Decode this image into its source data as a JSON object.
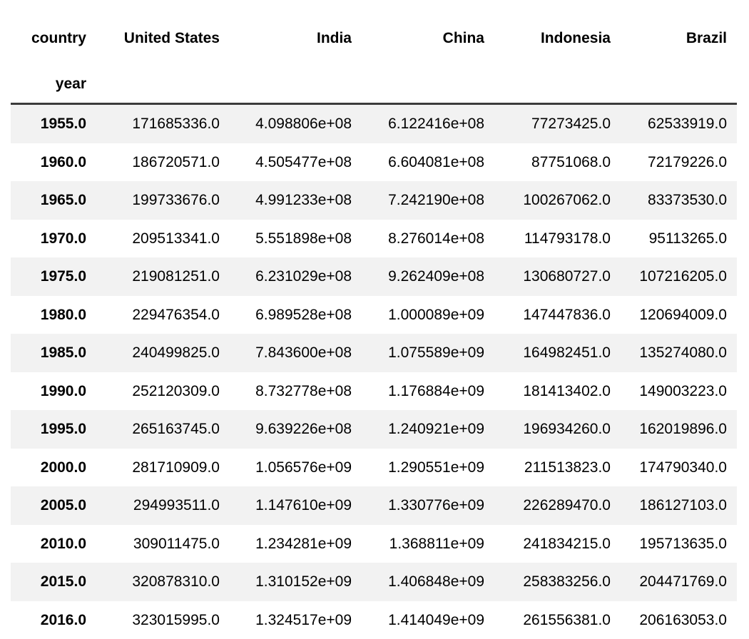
{
  "table": {
    "index_names": {
      "columns_axis_label": "country",
      "rows_axis_label": "year"
    },
    "columns": [
      "United States",
      "India",
      "China",
      "Indonesia",
      "Brazil"
    ],
    "index": [
      "1955.0",
      "1960.0",
      "1965.0",
      "1970.0",
      "1975.0",
      "1980.0",
      "1985.0",
      "1990.0",
      "1995.0",
      "2000.0",
      "2005.0",
      "2010.0",
      "2015.0",
      "2016.0"
    ],
    "rows": [
      {
        "year": "1955.0",
        "cells": [
          "171685336.0",
          "4.098806e+08",
          "6.122416e+08",
          "77273425.0",
          "62533919.0"
        ]
      },
      {
        "year": "1960.0",
        "cells": [
          "186720571.0",
          "4.505477e+08",
          "6.604081e+08",
          "87751068.0",
          "72179226.0"
        ]
      },
      {
        "year": "1965.0",
        "cells": [
          "199733676.0",
          "4.991233e+08",
          "7.242190e+08",
          "100267062.0",
          "83373530.0"
        ]
      },
      {
        "year": "1970.0",
        "cells": [
          "209513341.0",
          "5.551898e+08",
          "8.276014e+08",
          "114793178.0",
          "95113265.0"
        ]
      },
      {
        "year": "1975.0",
        "cells": [
          "219081251.0",
          "6.231029e+08",
          "9.262409e+08",
          "130680727.0",
          "107216205.0"
        ]
      },
      {
        "year": "1980.0",
        "cells": [
          "229476354.0",
          "6.989528e+08",
          "1.000089e+09",
          "147447836.0",
          "120694009.0"
        ]
      },
      {
        "year": "1985.0",
        "cells": [
          "240499825.0",
          "7.843600e+08",
          "1.075589e+09",
          "164982451.0",
          "135274080.0"
        ]
      },
      {
        "year": "1990.0",
        "cells": [
          "252120309.0",
          "8.732778e+08",
          "1.176884e+09",
          "181413402.0",
          "149003223.0"
        ]
      },
      {
        "year": "1995.0",
        "cells": [
          "265163745.0",
          "9.639226e+08",
          "1.240921e+09",
          "196934260.0",
          "162019896.0"
        ]
      },
      {
        "year": "2000.0",
        "cells": [
          "281710909.0",
          "1.056576e+09",
          "1.290551e+09",
          "211513823.0",
          "174790340.0"
        ]
      },
      {
        "year": "2005.0",
        "cells": [
          "294993511.0",
          "1.147610e+09",
          "1.330776e+09",
          "226289470.0",
          "186127103.0"
        ]
      },
      {
        "year": "2010.0",
        "cells": [
          "309011475.0",
          "1.234281e+09",
          "1.368811e+09",
          "241834215.0",
          "195713635.0"
        ]
      },
      {
        "year": "2015.0",
        "cells": [
          "320878310.0",
          "1.310152e+09",
          "1.406848e+09",
          "258383256.0",
          "204471769.0"
        ]
      },
      {
        "year": "2016.0",
        "cells": [
          "323015995.0",
          "1.324517e+09",
          "1.414049e+09",
          "261556381.0",
          "206163053.0"
        ]
      }
    ]
  },
  "chart_data": {
    "type": "table",
    "title": "",
    "xlabel": "year",
    "ylabel": "country",
    "categories": [
      "1955.0",
      "1960.0",
      "1965.0",
      "1970.0",
      "1975.0",
      "1980.0",
      "1985.0",
      "1990.0",
      "1995.0",
      "2000.0",
      "2005.0",
      "2010.0",
      "2015.0",
      "2016.0"
    ],
    "series": [
      {
        "name": "United States",
        "values": [
          171685336,
          186720571,
          199733676,
          209513341,
          219081251,
          229476354,
          240499825,
          252120309,
          265163745,
          281710909,
          294993511,
          309011475,
          320878310,
          323015995
        ]
      },
      {
        "name": "India",
        "values": [
          409880600,
          450547700,
          499123300,
          555189800,
          623102900,
          698952800,
          784360000,
          873277800,
          963922600,
          1056576000,
          1147610000,
          1234281000,
          1310152000,
          1324517000
        ]
      },
      {
        "name": "China",
        "values": [
          612241600,
          660408100,
          724219000,
          827601400,
          926240900,
          1000089000,
          1075589000,
          1176884000,
          1240921000,
          1290551000,
          1330776000,
          1368811000,
          1406848000,
          1414049000
        ]
      },
      {
        "name": "Indonesia",
        "values": [
          77273425,
          87751068,
          100267062,
          114793178,
          130680727,
          147447836,
          164982451,
          181413402,
          196934260,
          211513823,
          226289470,
          241834215,
          258383256,
          261556381
        ]
      },
      {
        "name": "Brazil",
        "values": [
          62533919,
          72179226,
          83373530,
          95113265,
          107216205,
          120694009,
          135274080,
          149003223,
          162019896,
          174790340,
          186127103,
          195713635,
          204471769,
          206163053
        ]
      }
    ]
  },
  "style": {
    "stripe_color": "#f2f2f2",
    "background_color": "#ffffff",
    "text_color": "#000000",
    "header_rule_color": "#3b3b3b"
  }
}
